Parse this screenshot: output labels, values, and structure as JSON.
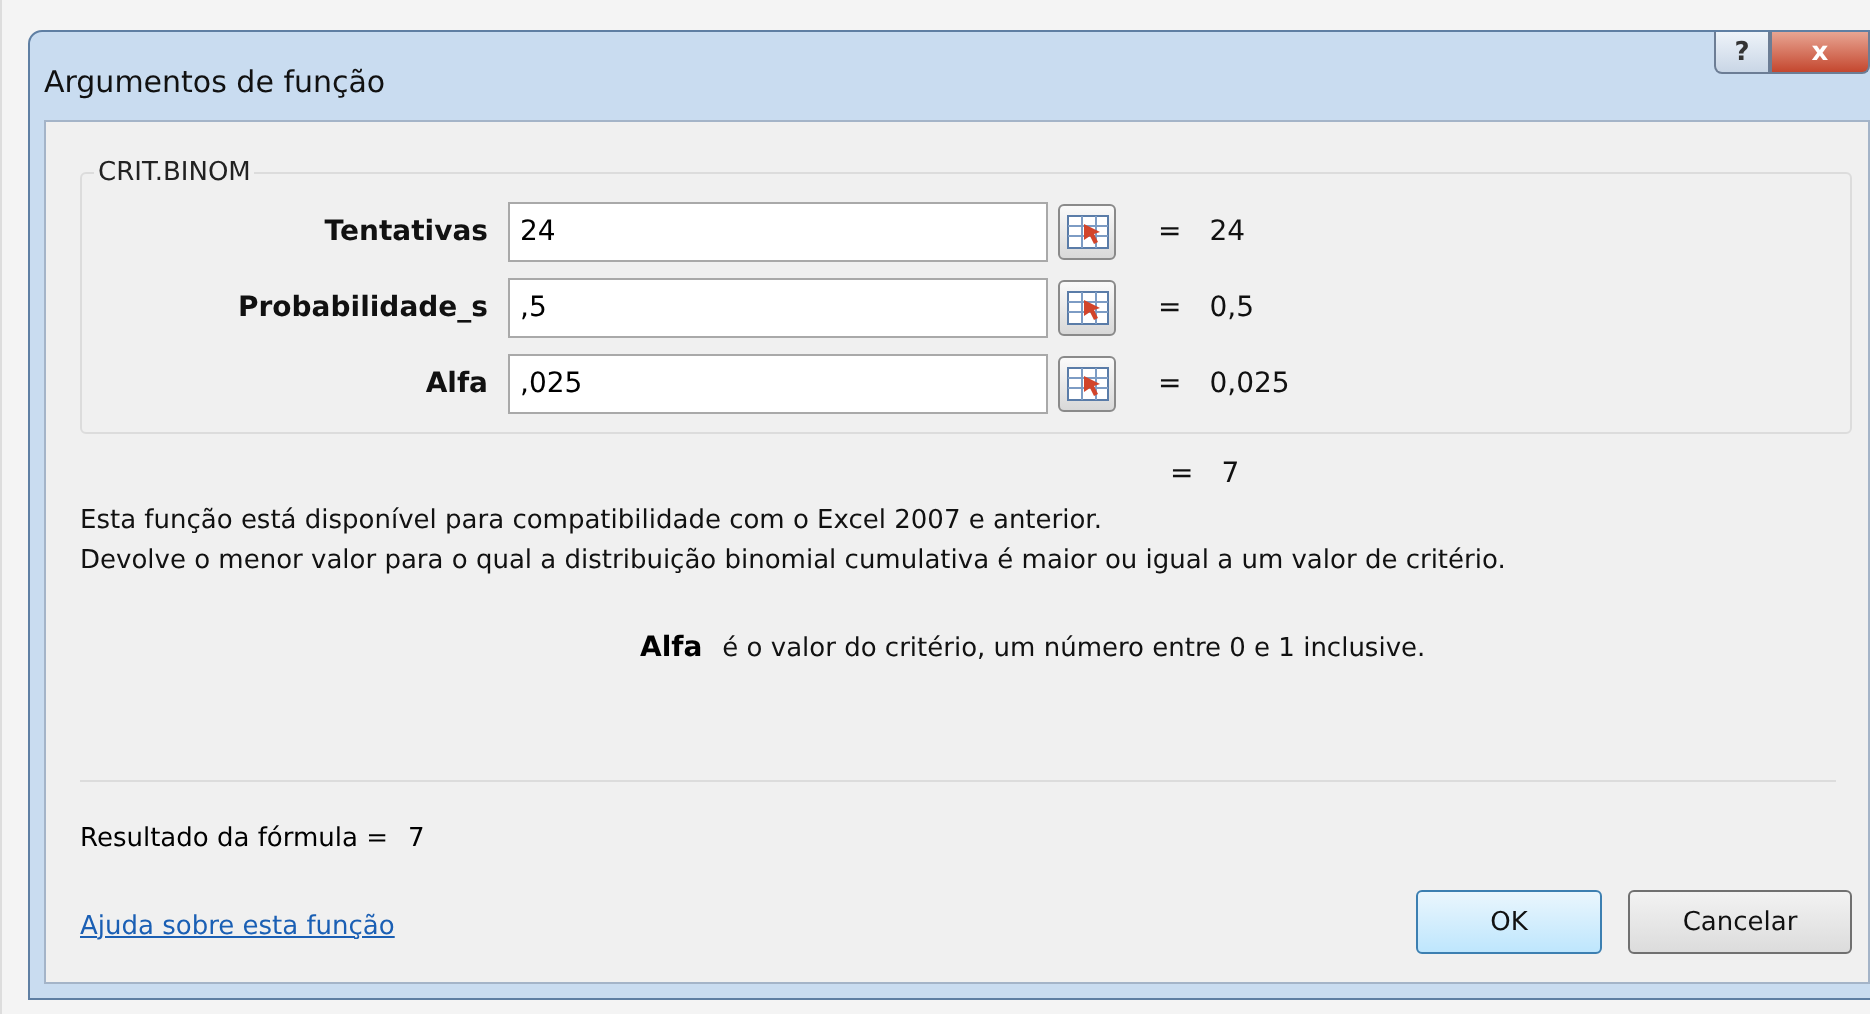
{
  "window": {
    "title": "Argumentos de função",
    "help_button": "?",
    "close_button": "x"
  },
  "function_group": {
    "name": "CRIT.BINOM",
    "arguments": [
      {
        "label": "Tentativas",
        "value": "24",
        "equals": "=",
        "result": "24"
      },
      {
        "label": "Probabilidade_s",
        "value": ",5",
        "equals": "=",
        "result": "0,5"
      },
      {
        "label": "Alfa",
        "value": ",025",
        "equals": "=",
        "result": "0,025"
      }
    ]
  },
  "function_result": {
    "equals": "=",
    "value": "7"
  },
  "description": [
    "Esta função está disponível para compatibilidade com o Excel 2007 e anterior.",
    "Devolve o menor valor para o qual a distribuição binomial cumulativa é maior ou igual a um valor de critério."
  ],
  "argument_help": {
    "name": "Alfa",
    "text": "é o valor do critério, um número entre 0 e 1 inclusive."
  },
  "formula_result": {
    "label": "Resultado da fórmula =",
    "value": "7"
  },
  "help_link": "Ajuda sobre esta função",
  "buttons": [
    {
      "label": "OK",
      "default": true
    },
    {
      "label": "Cancelar",
      "default": false
    }
  ]
}
